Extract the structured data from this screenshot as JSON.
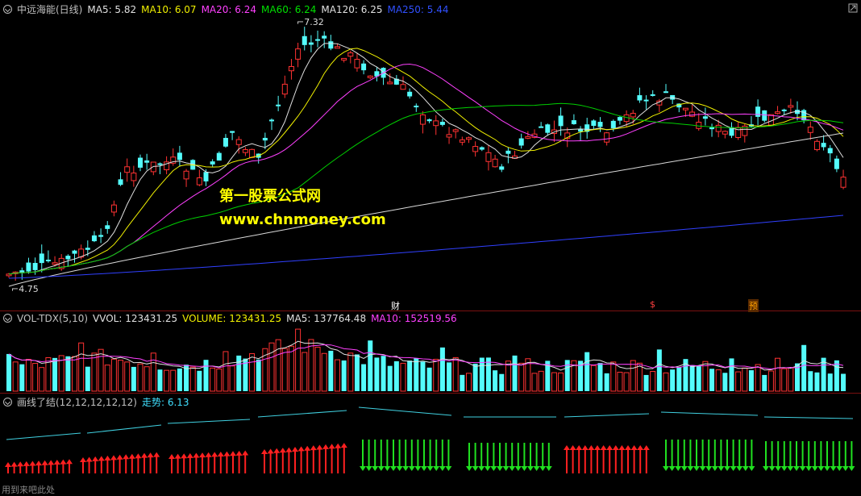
{
  "main": {
    "title": "中远海能(日线)",
    "indicators": [
      {
        "label": "MA5: 5.82",
        "color": "#e0e0e0"
      },
      {
        "label": "MA10: 6.07",
        "color": "#f0f000"
      },
      {
        "label": "MA20: 6.24",
        "color": "#ff40ff"
      },
      {
        "label": "MA60: 6.24",
        "color": "#00e000"
      },
      {
        "label": "MA120: 6.25",
        "color": "#e0e0e0"
      },
      {
        "label": "MA250: 5.44",
        "color": "#3050ff"
      }
    ],
    "high_label": "7.32",
    "low_label": "4.75",
    "watermark_line1": "第一股票公式网",
    "watermark_line2": "www.chnmoney.com",
    "markers": [
      {
        "text": "财",
        "color": "#fff"
      },
      {
        "text": "$",
        "color": "#ff4040"
      },
      {
        "text": "预",
        "color": "#ffa000"
      }
    ]
  },
  "volume": {
    "title": "VOL-TDX(5,10)",
    "indicators": [
      {
        "label": "VVOL: 123431.25",
        "color": "#e0e0e0"
      },
      {
        "label": "VOLUME: 123431.25",
        "color": "#f0f000"
      },
      {
        "label": "MA5: 137764.48",
        "color": "#e0e0e0"
      },
      {
        "label": "MA10: 152519.56",
        "color": "#ff40ff"
      }
    ]
  },
  "custom": {
    "title": "画线了结(12,12,12,12,12)",
    "indicators": [
      {
        "label": "走势: 6.13",
        "color": "#40e0ff"
      }
    ]
  },
  "footer": "用到来吧此处",
  "colors": {
    "up": "#ff3232",
    "down": "#54fcfc",
    "arrow_up": "#ff2020",
    "arrow_down": "#20e020",
    "trend": "#40d0e0"
  }
}
